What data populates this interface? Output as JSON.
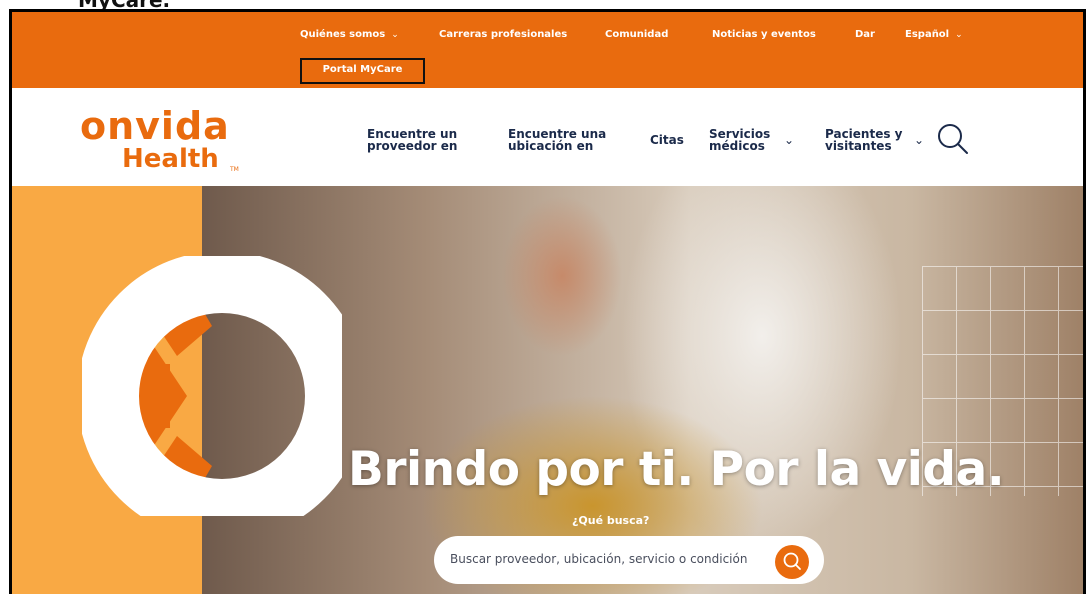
{
  "caption": "MyCare.",
  "top_nav": {
    "items": [
      {
        "label": "Quiénes somos",
        "has_dropdown": true
      },
      {
        "label": "Carreras profesionales",
        "has_dropdown": false
      },
      {
        "label": "Comunidad",
        "has_dropdown": false
      },
      {
        "label": "Noticias y eventos",
        "has_dropdown": false
      },
      {
        "label": "Dar",
        "has_dropdown": false
      },
      {
        "label": "Español",
        "has_dropdown": true
      }
    ],
    "portal_label": "Portal MyCare",
    "chevron": "⌄"
  },
  "logo": {
    "top": "onvida",
    "bottom": "Health",
    "tm": "TM"
  },
  "main_nav": {
    "find_provider": {
      "line1": "Encuentre un",
      "line2": "proveedor en"
    },
    "find_location": {
      "line1": "Encuentre una",
      "line2": "ubicación en"
    },
    "appointments": "Citas",
    "medical_services": {
      "line1": "Servicios",
      "line2": "médicos"
    },
    "patients_visitors": {
      "line1": "Pacientes y",
      "line2": "visitantes"
    },
    "chevron": "⌄",
    "search_icon": "search-icon"
  },
  "hero": {
    "title": "Brindo por ti. Por la vida.",
    "question": "¿Qué busca?",
    "search_placeholder": "Buscar proveedor, ubicación, servicio o condición"
  },
  "colors": {
    "brand_orange": "#e96b0e",
    "panel_orange": "#f9a944",
    "nav_text": "#1b2a4a",
    "annotation": "#111111"
  }
}
